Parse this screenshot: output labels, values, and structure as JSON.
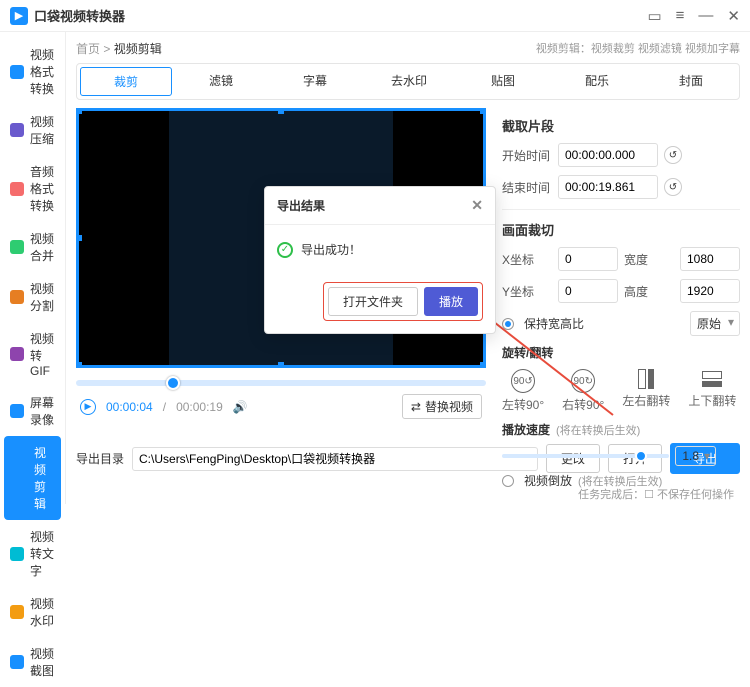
{
  "title": "口袋视频转换器",
  "breadcrumb": {
    "root": "首页",
    "current": "视频剪辑"
  },
  "top_hint": "视频剪辑：视频裁剪 视频滤镜 视频加字幕",
  "sidebar": [
    {
      "label": "视频格式转换",
      "icon": "#1890ff"
    },
    {
      "label": "视频压缩",
      "icon": "#6a5acd"
    },
    {
      "label": "音频格式转换",
      "icon": "#f56c6c"
    },
    {
      "label": "视频合并",
      "icon": "#2ecc71"
    },
    {
      "label": "视频分割",
      "icon": "#e67e22"
    },
    {
      "label": "视频转GIF",
      "icon": "#8e44ad"
    },
    {
      "label": "屏幕录像",
      "icon": "#1890ff"
    },
    {
      "label": "视频剪辑",
      "icon": "#1890ff",
      "active": true
    },
    {
      "label": "视频转文字",
      "icon": "#00bcd4"
    },
    {
      "label": "视频水印",
      "icon": "#f39c12"
    },
    {
      "label": "视频截图",
      "icon": "#1890ff"
    }
  ],
  "tabs": [
    "裁剪",
    "滤镜",
    "字幕",
    "去水印",
    "贴图",
    "配乐",
    "封面"
  ],
  "active_tab": "裁剪",
  "player": {
    "current": "00:00:04",
    "total": "00:00:19",
    "replace": "替换视频"
  },
  "panel": {
    "clip_title": "截取片段",
    "start_label": "开始时间",
    "start_val": "00:00:00.000",
    "end_label": "结束时间",
    "end_val": "00:00:19.861",
    "crop_title": "画面裁切",
    "x_label": "X坐标",
    "x_val": "0",
    "w_label": "宽度",
    "w_val": "1080",
    "y_label": "Y坐标",
    "y_val": "0",
    "h_label": "高度",
    "h_val": "1920",
    "aspect_label": "保持宽高比",
    "aspect_val": "原始",
    "rotate_title": "旋转/翻转",
    "rot": [
      "左转90°",
      "右转90°",
      "左右翻转",
      "上下翻转"
    ],
    "speed_label": "播放速度",
    "speed_hint": "(将在转换后生效)",
    "speed_val": "1.8",
    "reverse_label": "视频倒放",
    "reverse_hint": "(将在转换后生效)"
  },
  "export": {
    "label": "导出目录",
    "path": "C:\\Users\\FengPing\\Desktop\\口袋视频转换器",
    "change": "更改",
    "open": "打开",
    "export_btn": "导出"
  },
  "status": "☐ 不保存任何操作",
  "status_prefix": "任务完成后：",
  "modal": {
    "title": "导出结果",
    "success": "导出成功！",
    "open_folder": "打开文件夹",
    "play": "播放"
  }
}
